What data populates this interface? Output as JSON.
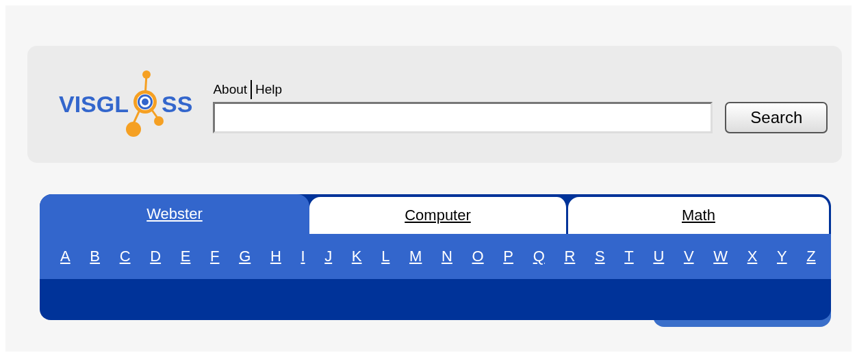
{
  "logo": {
    "before": "VISGL",
    "after": "SS"
  },
  "header_links": [
    "About",
    "Help"
  ],
  "search": {
    "button": "Search"
  },
  "tabs": [
    {
      "label": "Webster",
      "selected": true
    },
    {
      "label": "Computer",
      "selected": false
    },
    {
      "label": "Math",
      "selected": false
    }
  ],
  "letters": [
    "A",
    "B",
    "C",
    "D",
    "E",
    "F",
    "G",
    "H",
    "I",
    "J",
    "K",
    "L",
    "M",
    "N",
    "O",
    "P",
    "Q",
    "R",
    "S",
    "T",
    "U",
    "V",
    "W",
    "X",
    "Y",
    "Z"
  ]
}
